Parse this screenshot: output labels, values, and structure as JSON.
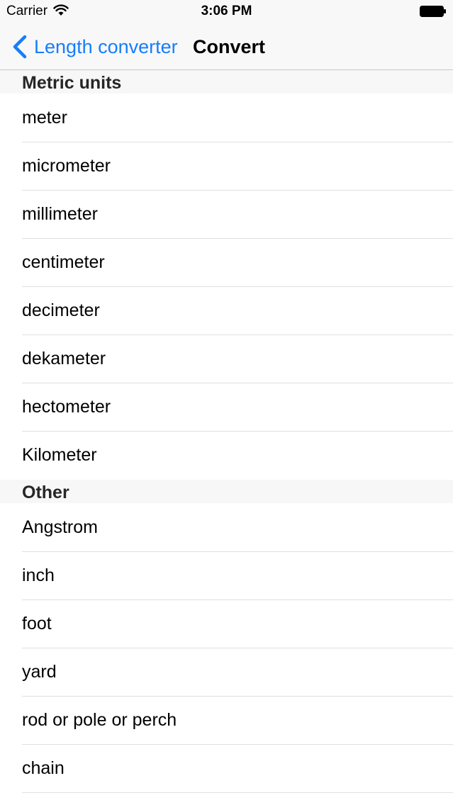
{
  "status_bar": {
    "carrier": "Carrier",
    "time": "3:06 PM",
    "wifi_icon": "wifi-icon",
    "battery_icon": "battery-icon"
  },
  "nav_bar": {
    "back_label": "Length converter",
    "title": "Convert",
    "accent_color": "#157efb"
  },
  "sections": [
    {
      "header": "Metric units",
      "items": [
        "meter",
        "micrometer",
        "millimeter",
        "centimeter",
        "decimeter",
        "dekameter",
        "hectometer",
        "Kilometer"
      ]
    },
    {
      "header": "Other",
      "items": [
        "Angstrom",
        "inch",
        "foot",
        "yard",
        "rod or pole or perch",
        "chain"
      ]
    }
  ]
}
